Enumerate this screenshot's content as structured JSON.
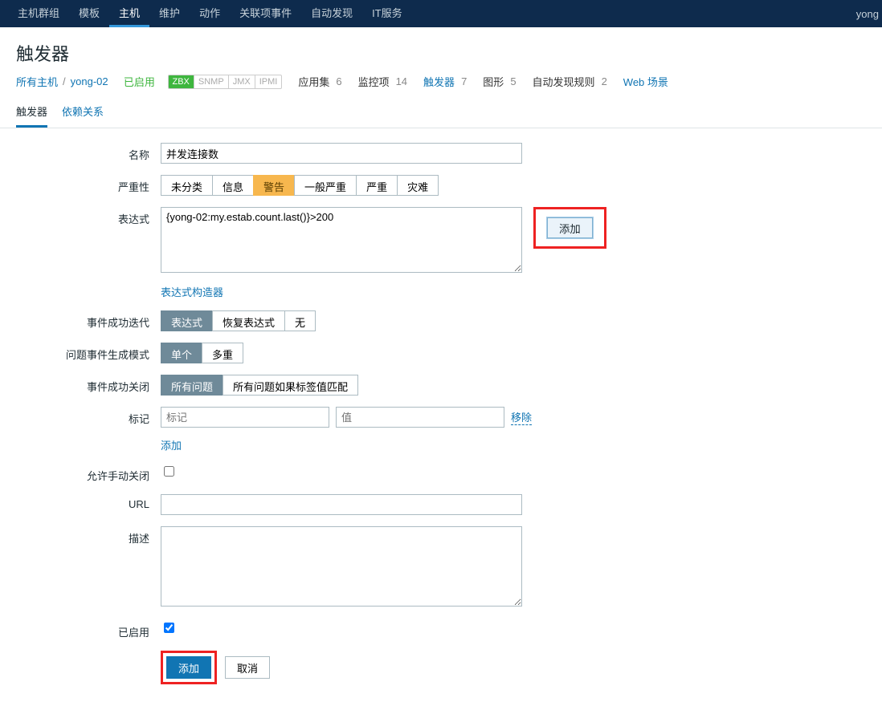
{
  "topnav": {
    "items": [
      "主机群组",
      "模板",
      "主机",
      "维护",
      "动作",
      "关联项事件",
      "自动发现",
      "IT服务"
    ],
    "active_index": 2,
    "user": "yong"
  },
  "page_title": "触发器",
  "breadcrumb": {
    "all_hosts": "所有主机",
    "host": "yong-02",
    "enabled": "已启用",
    "proto": {
      "zbx": "ZBX",
      "snmp": "SNMP",
      "jmx": "JMX",
      "ipmi": "IPMI"
    },
    "counts": [
      {
        "label": "应用集",
        "val": "6",
        "link": false
      },
      {
        "label": "监控项",
        "val": "14",
        "link": false
      },
      {
        "label": "触发器",
        "val": "7",
        "link": true
      },
      {
        "label": "图形",
        "val": "5",
        "link": false
      },
      {
        "label": "自动发现规则",
        "val": "2",
        "link": false
      }
    ],
    "web_scenario": "Web 场景"
  },
  "tabs": {
    "trigger": "触发器",
    "deps": "依赖关系"
  },
  "form": {
    "labels": {
      "name": "名称",
      "severity": "严重性",
      "expression": "表达式",
      "event_ok": "事件成功迭代",
      "problem_gen": "问题事件生成模式",
      "event_close": "事件成功关闭",
      "tags": "标记",
      "manual_close": "允许手动关闭",
      "url": "URL",
      "description": "描述",
      "enabled": "已启用"
    },
    "name_value": "并发连接数",
    "severity_options": [
      "未分类",
      "信息",
      "警告",
      "一般严重",
      "严重",
      "灾难"
    ],
    "severity_selected_index": 2,
    "expression_value": "{yong-02:my.estab.count.last()}>200",
    "expression_add_btn": "添加",
    "expression_builder": "表达式构造器",
    "event_ok_options": [
      "表达式",
      "恢复表达式",
      "无"
    ],
    "event_ok_selected_index": 0,
    "problem_gen_options": [
      "单个",
      "多重"
    ],
    "problem_gen_selected_index": 0,
    "event_close_options": [
      "所有问题",
      "所有问题如果标签值匹配"
    ],
    "event_close_selected_index": 0,
    "tag_placeholder_name": "标记",
    "tag_placeholder_value": "值",
    "tag_remove": "移除",
    "tag_add": "添加",
    "enabled_checked": true,
    "submit": "添加",
    "cancel": "取消"
  }
}
